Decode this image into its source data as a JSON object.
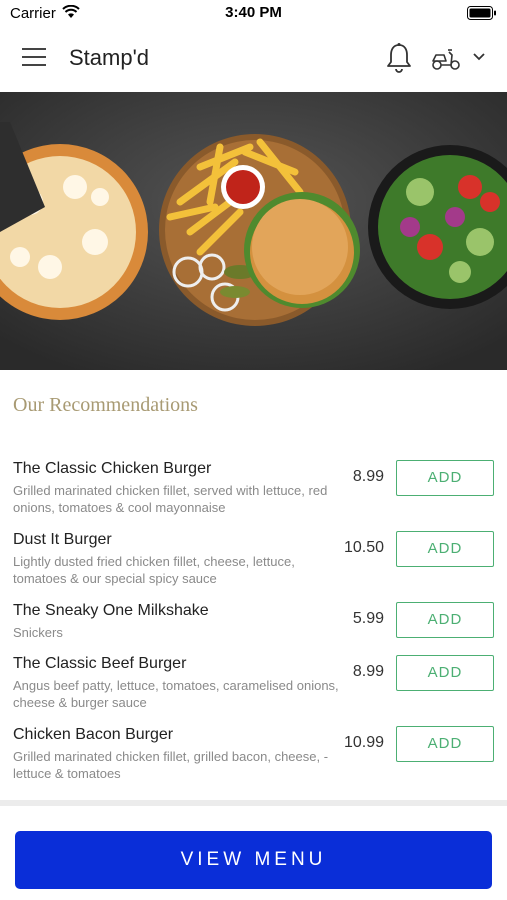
{
  "status_bar": {
    "carrier": "Carrier",
    "time": "3:40 PM"
  },
  "header": {
    "title": "Stamp'd",
    "icons": [
      "menu-icon",
      "bell-icon",
      "scooter-icon",
      "chevron-down-icon"
    ]
  },
  "section": {
    "title": "Our Recommendations"
  },
  "items": [
    {
      "name": "The Classic Chicken Burger",
      "description": "Grilled marinated chicken fillet, served with lettuce, red onions, tomatoes & cool mayonnaise",
      "price": "8.99",
      "button": "ADD"
    },
    {
      "name": "Dust It Burger",
      "description": "Lightly dusted fried chicken fillet, cheese, lettuce, tomatoes & our special spicy sauce",
      "price": "10.50",
      "button": "ADD"
    },
    {
      "name": "The Sneaky One Milkshake",
      "description": "Snickers",
      "price": "5.99",
      "button": "ADD"
    },
    {
      "name": "The Classic Beef Burger",
      "description": "Angus beef patty, lettuce, tomatoes, caramelised onions, cheese & burger sauce",
      "price": "8.99",
      "button": "ADD"
    },
    {
      "name": "Chicken Bacon Burger",
      "description": "Grilled marinated chicken fillet, grilled bacon, cheese, - lettuce & tomatoes",
      "price": "10.99",
      "button": "ADD"
    }
  ],
  "footer": {
    "view_menu": "VIEW MENU"
  },
  "colors": {
    "accent_green": "#4caf73",
    "primary_blue": "#0a2ed8",
    "section_gold": "#a89a73"
  }
}
